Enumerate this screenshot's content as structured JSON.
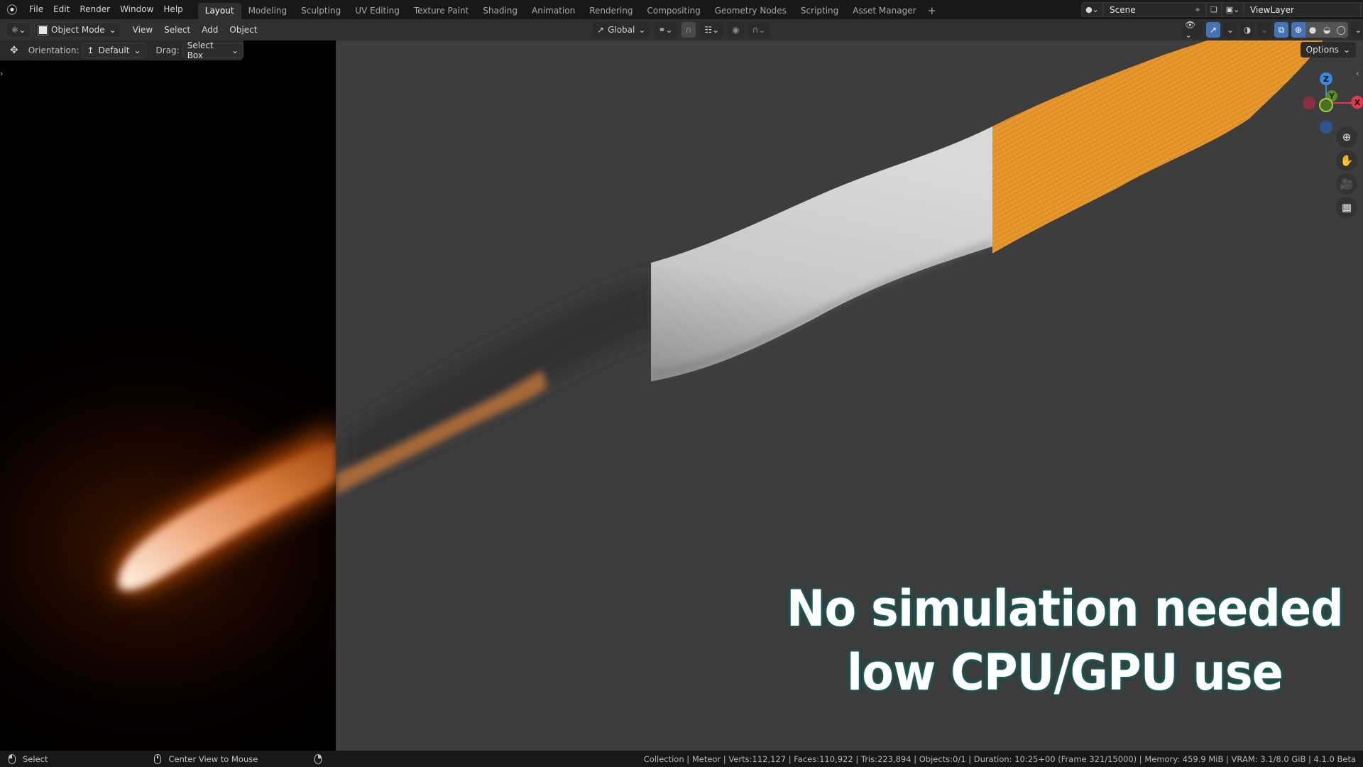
{
  "topbar": {
    "menus": [
      "File",
      "Edit",
      "Render",
      "Window",
      "Help"
    ],
    "workspaces": [
      "Layout",
      "Modeling",
      "Sculpting",
      "UV Editing",
      "Texture Paint",
      "Shading",
      "Animation",
      "Rendering",
      "Compositing",
      "Geometry Nodes",
      "Scripting",
      "Asset Manager"
    ],
    "active_workspace": "Layout",
    "add_workspace": "+",
    "scene": "Scene",
    "view_layer": "ViewLayer"
  },
  "header": {
    "mode": "Object Mode",
    "menus": [
      "View",
      "Select",
      "Add",
      "Object"
    ],
    "transform_orientation": "Global",
    "options_label": "Options"
  },
  "tool_settings": {
    "orientation_label": "Orientation:",
    "orientation_value": "Default",
    "drag_label": "Drag:",
    "drag_value": "Select Box"
  },
  "gizmo": {
    "x": "X",
    "y": "Y",
    "z": "Z"
  },
  "colors": {
    "accent_blue": "#4672b8",
    "selection_orange": "#f0a030",
    "axis_x": "#e0394f",
    "axis_y": "#7fb32a",
    "axis_z": "#3b86e0"
  },
  "caption": {
    "line1": "No simulation needed",
    "line2": "low CPU/GPU use"
  },
  "statusbar": {
    "left_click": "Select",
    "middle_click": "Center View to Mouse",
    "stats": "Collection | Meteor | Verts:112,127 | Faces:110,922 | Tris:223,894 | Objects:0/1 | Duration: 10:25+00 (Frame 321/15000) | Memory: 459.9 MiB | VRAM: 3.1/8.0 GiB | 4.1.0 Beta"
  }
}
